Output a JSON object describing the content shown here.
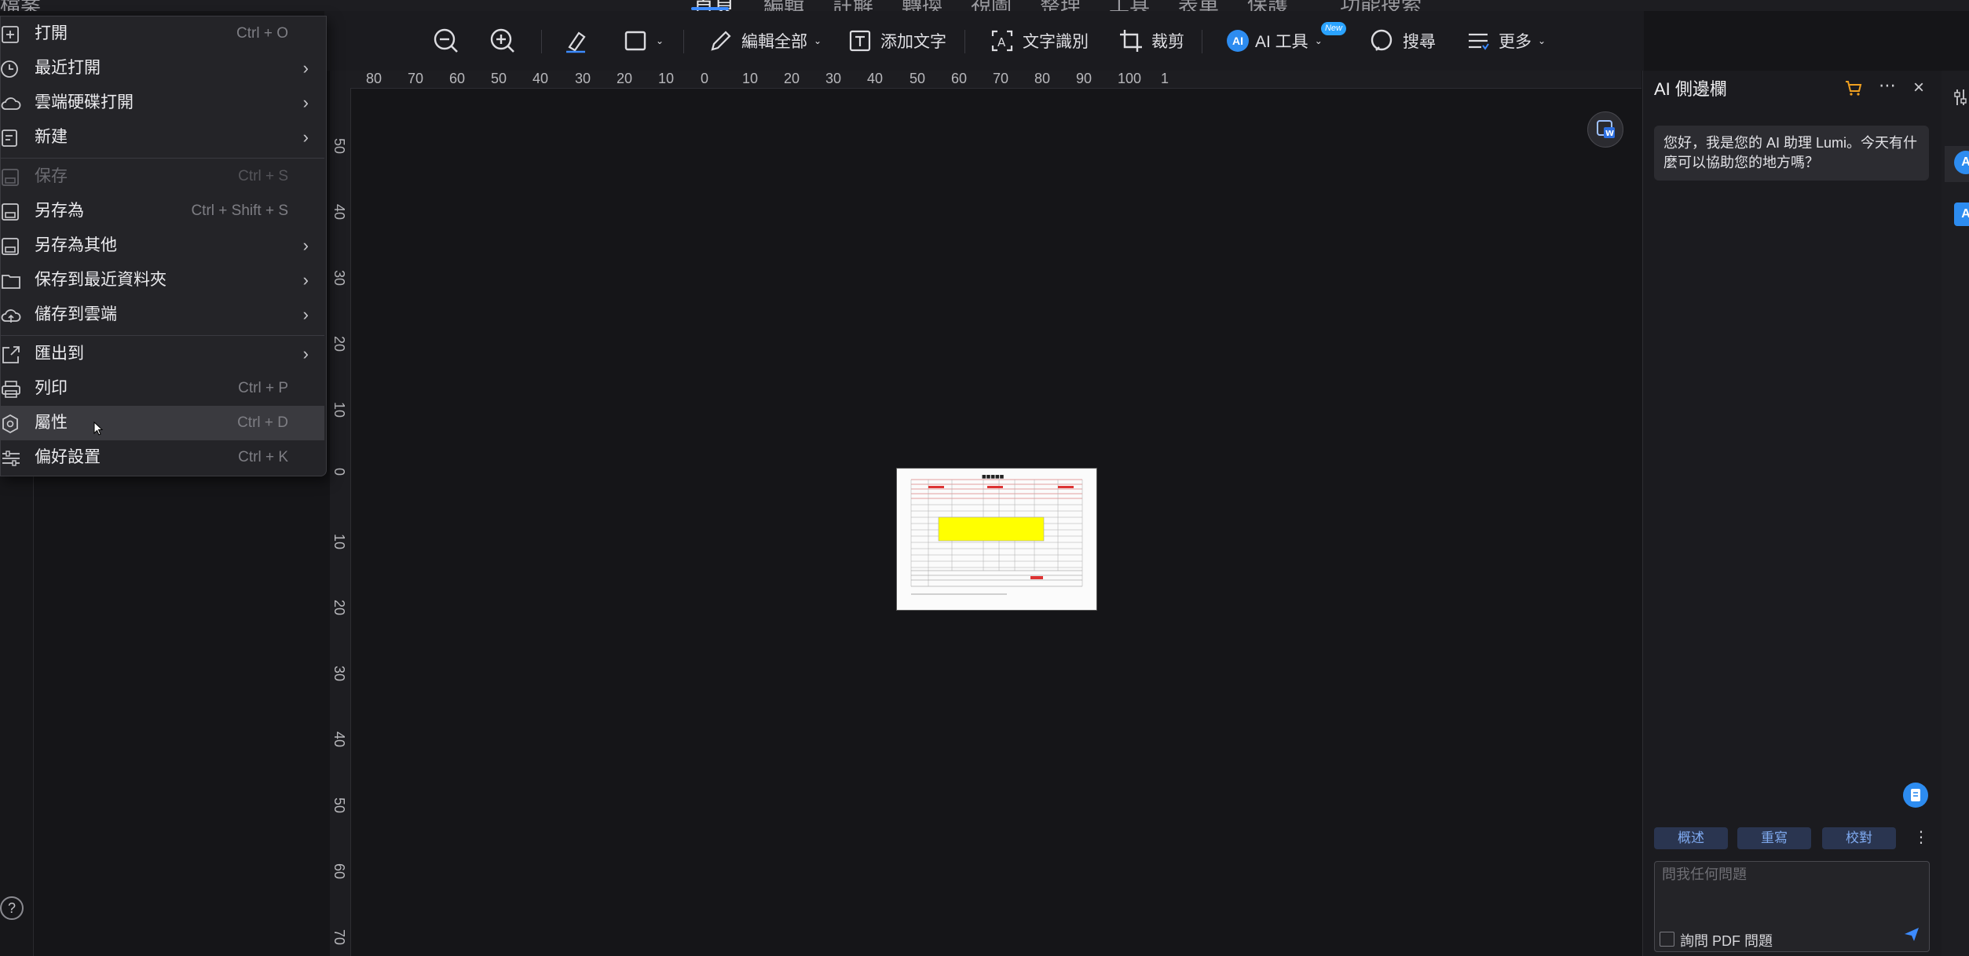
{
  "menubar": {
    "tabs": [
      "首頁",
      "編輯",
      "註解",
      "轉換",
      "視圖",
      "整理",
      "工具",
      "表單",
      "保護"
    ],
    "active_tab": "首頁",
    "feature_search": "功能搜索"
  },
  "toolbar": {
    "zoom_out_icon": "zoom-out-icon",
    "zoom_in_icon": "zoom-in-icon",
    "edit_all": "編輯全部",
    "add_text": "添加文字",
    "ocr": "文字識別",
    "crop": "裁剪",
    "ai_tools": "AI 工具",
    "new_badge": "New",
    "search": "搜尋",
    "more": "更多"
  },
  "file_menu": {
    "items": [
      {
        "label": "打開",
        "shortcut": "Ctrl + O",
        "icon": "open-icon"
      },
      {
        "label": "最近打開",
        "arrow": "›",
        "icon": "clock-icon"
      },
      {
        "label": "雲端硬碟打開",
        "arrow": "›",
        "icon": "cloud-icon"
      },
      {
        "label": "新建",
        "arrow": "›",
        "icon": "new-doc-icon"
      },
      {
        "label": "保存",
        "shortcut": "Ctrl + S",
        "icon": "save-icon",
        "disabled": true
      },
      {
        "label": "另存為",
        "shortcut": "Ctrl + Shift + S",
        "icon": "save-as-icon"
      },
      {
        "label": "另存為其他",
        "arrow": "›",
        "icon": "save-other-icon"
      },
      {
        "label": "保存到最近資料夾",
        "arrow": "›",
        "icon": "folder-icon"
      },
      {
        "label": "儲存到雲端",
        "arrow": "›",
        "icon": "cloud-upload-icon"
      },
      {
        "label": "匯出到",
        "arrow": "›",
        "icon": "export-icon"
      },
      {
        "label": "列印",
        "shortcut": "Ctrl + P",
        "icon": "print-icon"
      },
      {
        "label": "屬性",
        "shortcut": "Ctrl + D",
        "icon": "properties-icon"
      },
      {
        "label": "偏好設置",
        "shortcut": "Ctrl + K",
        "icon": "preferences-icon"
      }
    ]
  },
  "ruler": {
    "top": [
      "80",
      "70",
      "60",
      "50",
      "40",
      "30",
      "20",
      "10",
      "0",
      "10",
      "20",
      "30",
      "40",
      "50",
      "60",
      "70",
      "80",
      "90",
      "100",
      "1"
    ],
    "left": [
      "50",
      "40",
      "30",
      "20",
      "10",
      "0",
      "10",
      "20",
      "30",
      "40",
      "50",
      "60",
      "70"
    ]
  },
  "ai_sidebar": {
    "title": "AI 側邊欄",
    "greeting": "您好，我是您的 AI 助理 Lumi。今天有什麼可以協助您的地方嗎？",
    "chips": [
      "概述",
      "重寫",
      "校對"
    ],
    "input_placeholder": "問我任何問題",
    "pdf_checkbox_label": "詢問 PDF 問題"
  },
  "help": "?",
  "colors": {
    "accent": "#3d8bff",
    "highlight": "#ffff00"
  }
}
